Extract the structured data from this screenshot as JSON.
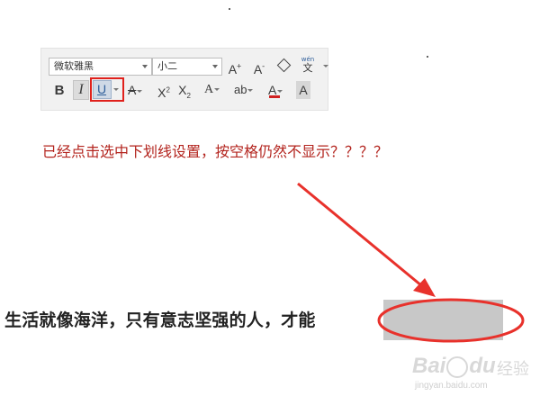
{
  "toolbar": {
    "font_name": "微软雅黑",
    "font_size": "小二",
    "grow_font_label": "A",
    "grow_font_sup": "+",
    "shrink_font_label": "A",
    "shrink_font_sup": "-",
    "pinyin_top": "wén",
    "pinyin_bottom": "文",
    "bold_label": "B",
    "italic_label": "I",
    "underline_label": "U",
    "strikethrough_label": "A",
    "superscript_base": "X",
    "superscript_exp": "2",
    "subscript_base": "X",
    "subscript_exp": "2",
    "text_effect_label": "A",
    "phonetic_label": "ab",
    "font_color_label": "A",
    "char_shading_label": "A",
    "underline_highlight_color": "#e0211c",
    "font_color_bar": "#d02020"
  },
  "question": {
    "text": "已经点击选中下划线设置，按空格仍然不显示？？？？",
    "color": "#b3241e"
  },
  "document": {
    "sentence": "生活就像海洋，只有意志坚强的人，才能"
  },
  "annotation": {
    "arrow_color": "#e8312b",
    "ellipse_color": "#e8312b"
  },
  "watermark": {
    "logo_left": "Bai",
    "logo_right": "du",
    "brand": "经验",
    "url": "jingyan.baidu.com"
  }
}
